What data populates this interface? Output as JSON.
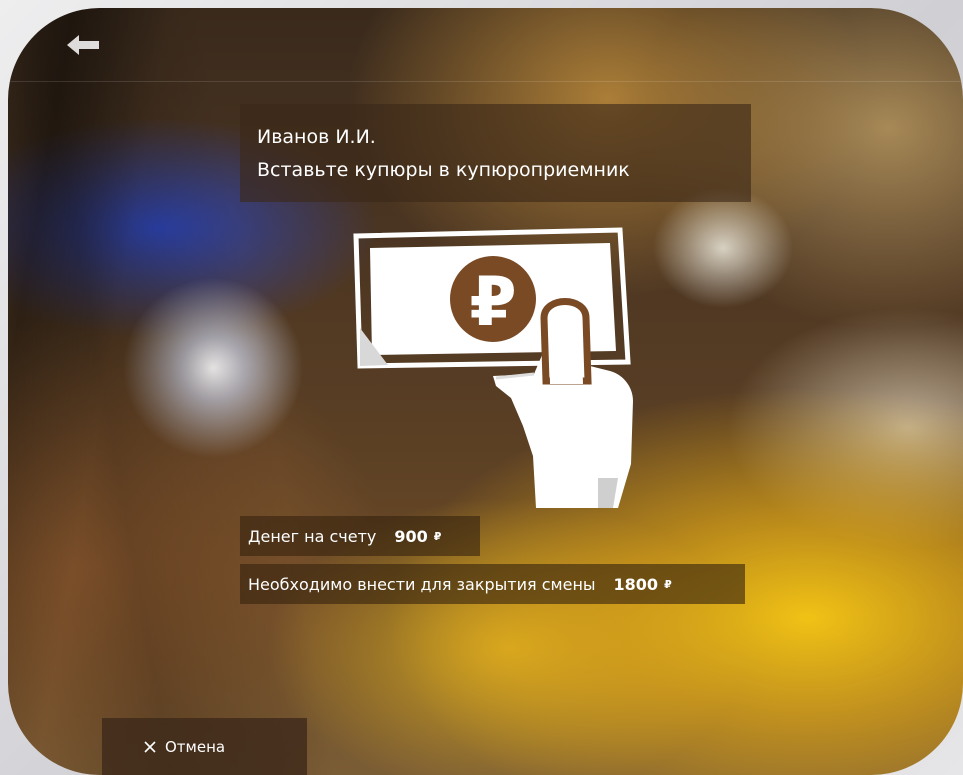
{
  "header": {
    "user_name": "Иванов И.И.",
    "instruction": "Вставьте купюры в купюроприемник"
  },
  "illustration": {
    "icon": "banknote-ruble-hand-icon",
    "currency_symbol": "₽"
  },
  "balance": {
    "label": "Денег на счету",
    "value": "900",
    "currency": "₽"
  },
  "required": {
    "label": "Необходимо внести для закрытия смены",
    "value": "1800",
    "currency": "₽"
  },
  "footer": {
    "cancel_label": "Отмена",
    "cancel_icon": "close-icon"
  },
  "colors": {
    "panel": "#3c2819",
    "text": "#ffffff",
    "accent_brown": "#7a4a25"
  }
}
